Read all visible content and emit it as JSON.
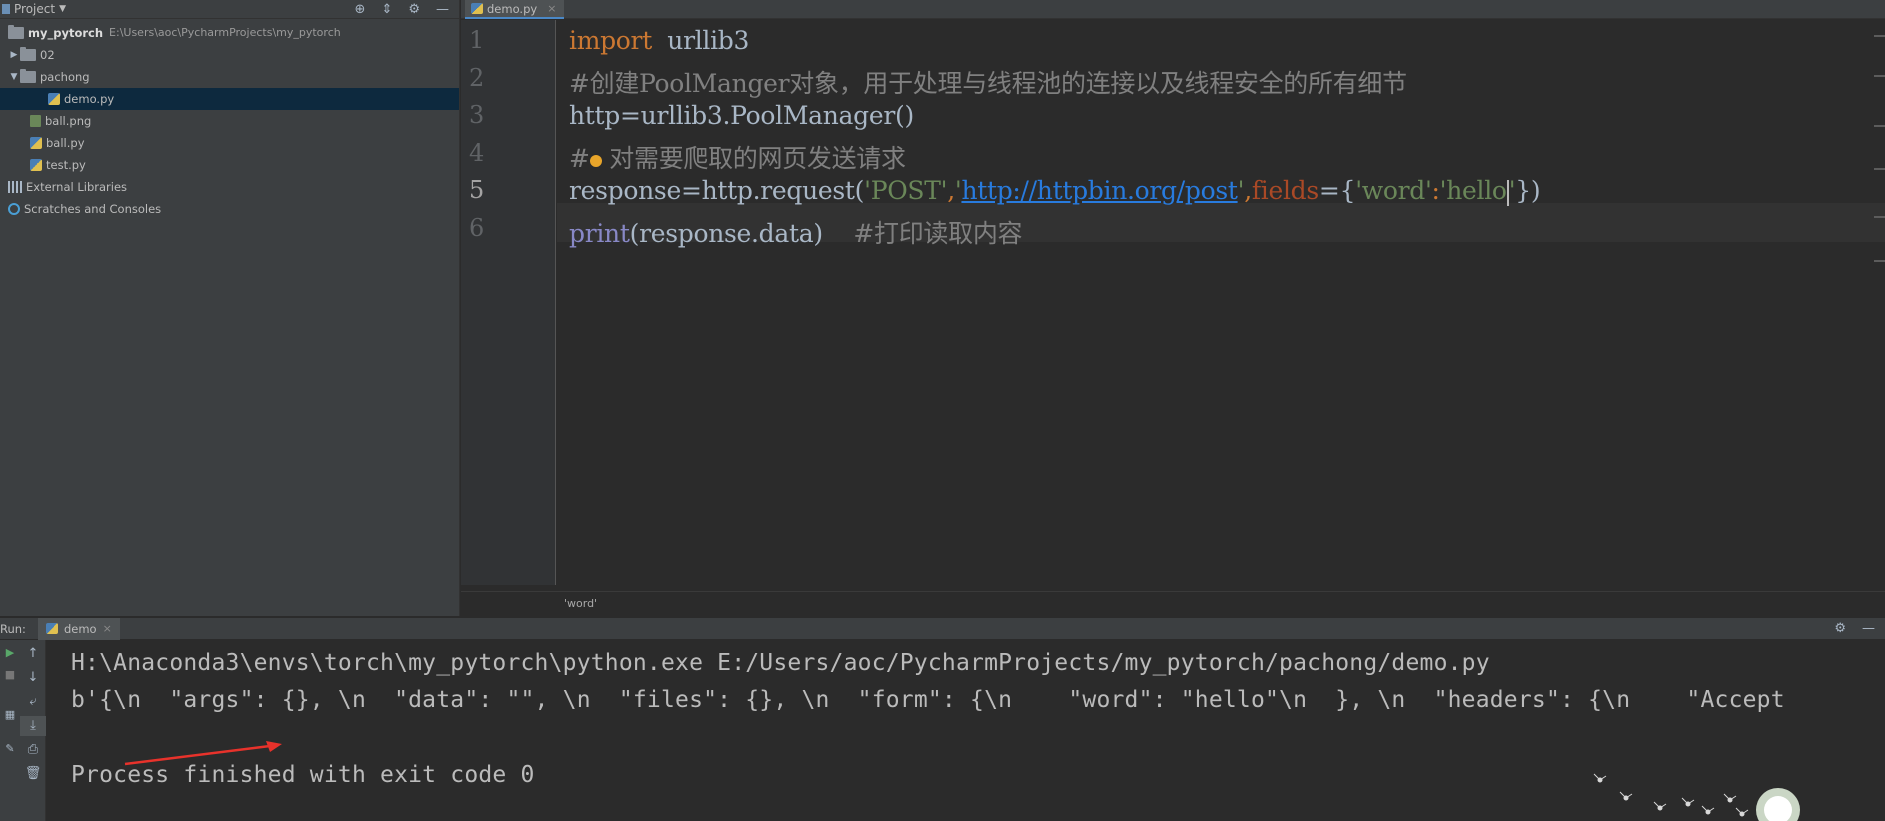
{
  "project_panel": {
    "title": "Project",
    "root": {
      "name": "my_pytorch",
      "path": "E:\\Users\\aoc\\PycharmProjects\\my_pytorch"
    },
    "items": [
      {
        "label": "02"
      },
      {
        "label": "pachong"
      },
      {
        "label": "demo.py"
      },
      {
        "label": "ball.png"
      },
      {
        "label": "ball.py"
      },
      {
        "label": "test.py"
      },
      {
        "label": "External Libraries"
      },
      {
        "label": "Scratches and Consoles"
      }
    ]
  },
  "editor": {
    "tab": {
      "label": "demo.py"
    },
    "line_numbers": [
      "1",
      "2",
      "3",
      "4",
      "5",
      "6"
    ],
    "lines": {
      "l1": {
        "kw": "import",
        "rest": "  urllib3"
      },
      "l2": {
        "comment": "#创建PoolManger对象，用于处理与线程池的连接以及线程安全的所有细节"
      },
      "l3": {
        "text": "http=urllib3.PoolManager()"
      },
      "l4": {
        "hash": "#",
        "comment": " 对需要爬取的网页发送请求"
      },
      "l5": {
        "p1": "response=http.request(",
        "s1": "'POST'",
        "c1": ",",
        "q1": "'",
        "url": "http://httpbin.org/post",
        "q2": "'",
        "c2": ",",
        "param": "fields",
        "p2": "={",
        "s2": "'word'",
        "c3": ":",
        "s3": "'hello",
        "q3": "'",
        "p3": "})"
      },
      "l6": {
        "builtin": "print",
        "rest": "(response.data)    ",
        "comment": "#打印读取内容"
      }
    },
    "breadcrumb": "'word'"
  },
  "run_panel": {
    "label": "Run:",
    "tab": "demo",
    "output": [
      "H:\\Anaconda3\\envs\\torch\\my_pytorch\\python.exe E:/Users/aoc/PycharmProjects/my_pytorch/pachong/demo.py",
      "b'{\\n  \"args\": {}, \\n  \"data\": \"\", \\n  \"files\": {}, \\n  \"form\": {\\n    \"word\": \"hello\"\\n  }, \\n  \"headers\": {\\n    \"Accept",
      "",
      "Process finished with exit code 0"
    ]
  },
  "colors": {
    "background": "#2b2b2b",
    "panel": "#3c3f41",
    "keyword": "#cc7832",
    "string": "#6a8759",
    "comment": "#808080",
    "url": "#287bde",
    "annotation_arrow": "#e8322b"
  }
}
